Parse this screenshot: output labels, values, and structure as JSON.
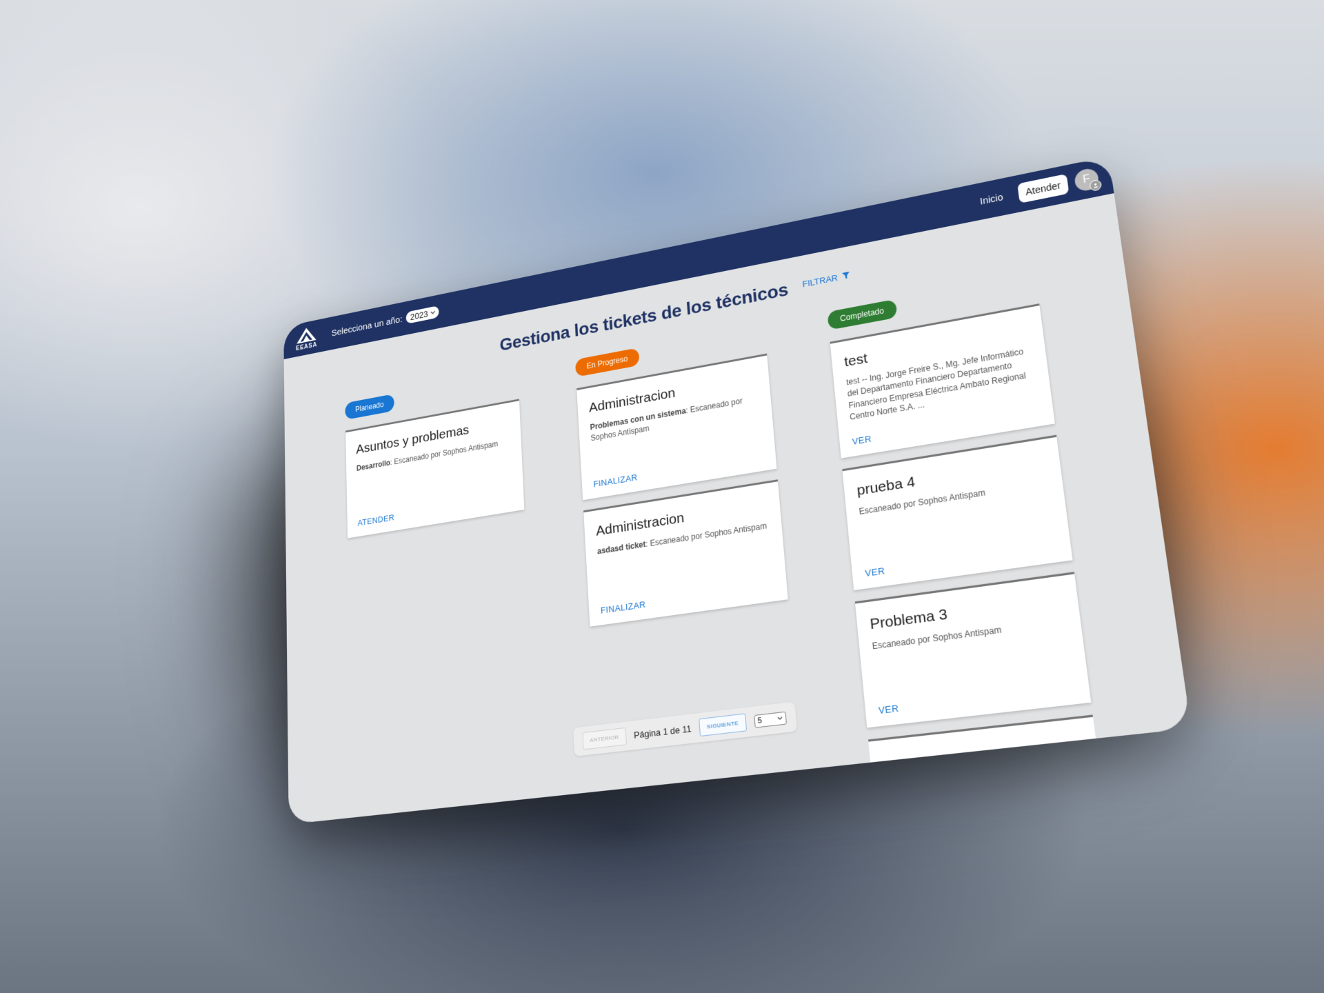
{
  "header": {
    "logo_text": "EEASA",
    "year_label": "Selecciona un año:",
    "year_value": "2023",
    "nav_inicio": "Inicio",
    "nav_atender": "Atender",
    "avatar_initial": "F"
  },
  "main": {
    "title": "Gestiona los tickets de los técnicos",
    "filter_label": "FILTRAR"
  },
  "columns": [
    {
      "status": "Planeado",
      "cards": [
        {
          "title": "Asuntos y problemas",
          "category": "Desarrollo",
          "body": ": Escaneado por Sophos Antispam",
          "action": "ATENDER"
        }
      ]
    },
    {
      "status": "En Progreso",
      "cards": [
        {
          "title": "Administracion",
          "category": "Problemas con un sistema",
          "body": ": Escaneado por Sophos Antispam",
          "action": "FINALIZAR"
        },
        {
          "title": "Administracion",
          "category": "asdasd ticket",
          "body": ": Escaneado por Sophos Antispam",
          "action": "FINALIZAR"
        }
      ]
    },
    {
      "status": "Completado",
      "cards": [
        {
          "title": "test",
          "category": "",
          "body": "test -- Ing. Jorge Freire S., Mg. Jefe Informático del Departamento Financiero Departamento Financiero Empresa Eléctrica Ambato Regional Centro Norte S.A. ...",
          "action": "VER"
        },
        {
          "title": "prueba 4",
          "category": "",
          "body": "Escaneado por Sophos Antispam",
          "action": "VER"
        },
        {
          "title": "Problema 3",
          "category": "",
          "body": "Escaneado por Sophos Antispam",
          "action": "VER"
        }
      ]
    }
  ],
  "pagination": {
    "prev_label": "ANTERIOR",
    "page_text": "Página 1 de 11",
    "next_label": "SIGUIENTE",
    "page_size": "5"
  },
  "colors": {
    "navbar": "#1f3263",
    "title": "#1f3263",
    "planeado": "#1976d2",
    "en_progreso": "#ed6c02",
    "completado": "#2e7d32",
    "action": "#1976d2"
  }
}
